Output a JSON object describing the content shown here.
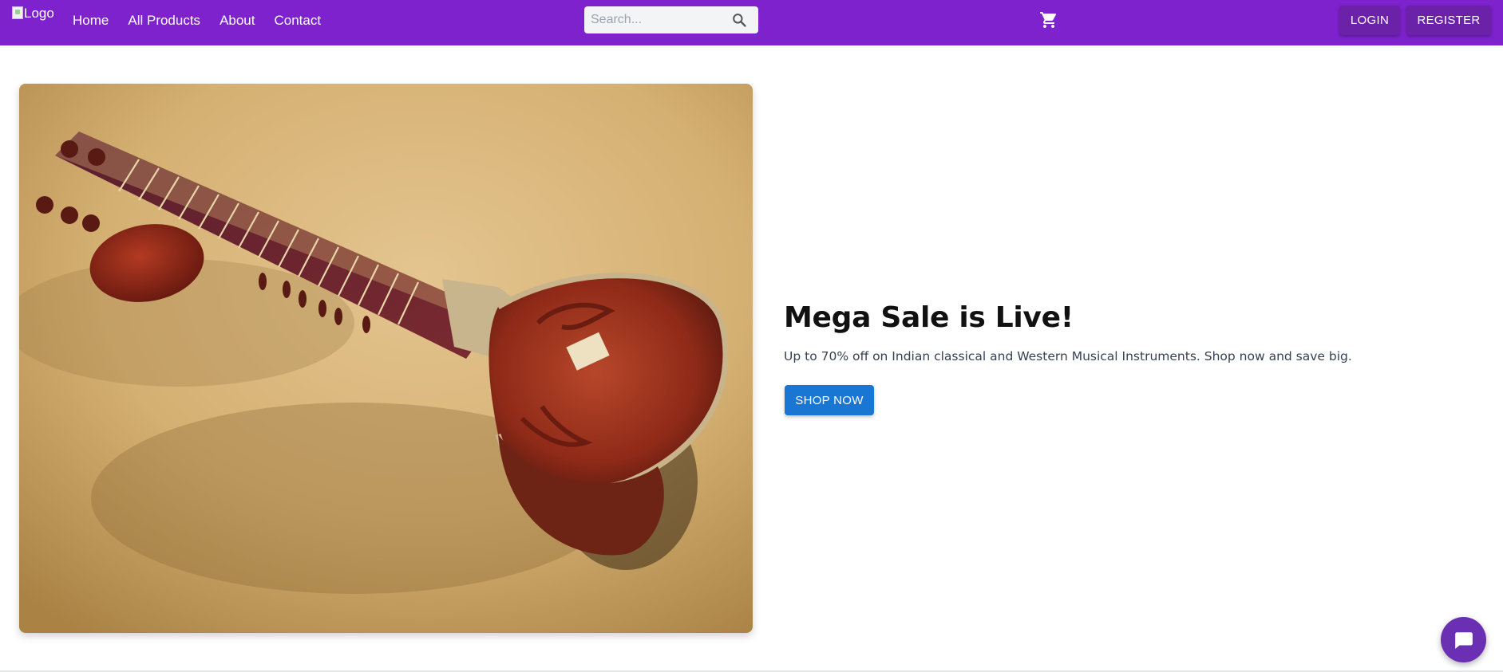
{
  "navbar": {
    "logo_alt": "Logo",
    "links": [
      "Home",
      "All Products",
      "About",
      "Contact"
    ],
    "search_placeholder": "Search...",
    "login_label": "LOGIN",
    "register_label": "REGISTER",
    "cart_icon": "cart-icon",
    "background_color": "#7e22ce"
  },
  "hero": {
    "title": "Mega Sale is Live!",
    "subtitle": "Up to 70% off on Indian classical and Western Musical Instruments. Shop now and save big.",
    "cta_label": "SHOP NOW",
    "cta_color": "#1976d2"
  },
  "chat": {
    "icon": "chat-icon",
    "color": "#6b2fb3"
  }
}
